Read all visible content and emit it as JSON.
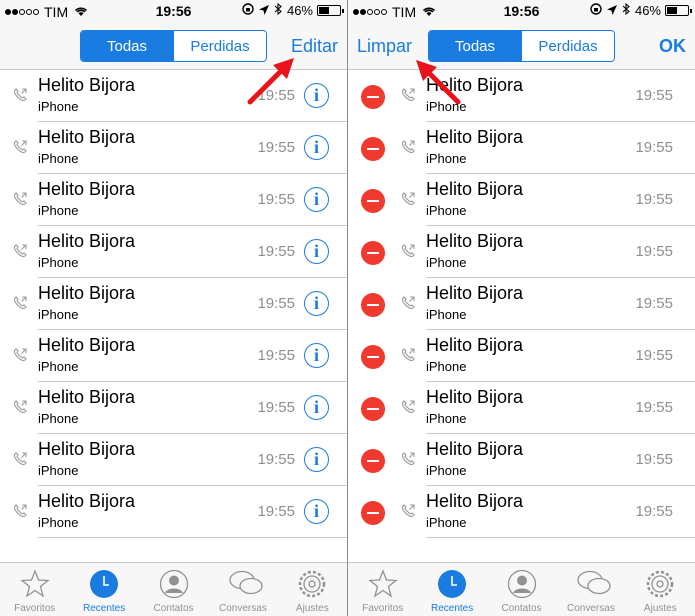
{
  "status": {
    "carrier": "TIM",
    "time": "19:56",
    "battery": "46%",
    "signal_filled": 2,
    "signal_total": 5,
    "battery_level": 0.46
  },
  "left": {
    "segments": [
      "Todas",
      "Perdidas"
    ],
    "active_segment": "Todas",
    "edit_label": "Editar"
  },
  "right": {
    "segments": [
      "Todas",
      "Perdidas"
    ],
    "active_segment": "Todas",
    "clear_label": "Limpar",
    "ok_label": "OK"
  },
  "calls": [
    {
      "name": "Helito Bijora",
      "type": "iPhone",
      "time": "19:55"
    },
    {
      "name": "Helito Bijora",
      "type": "iPhone",
      "time": "19:55"
    },
    {
      "name": "Helito Bijora",
      "type": "iPhone",
      "time": "19:55"
    },
    {
      "name": "Helito Bijora",
      "type": "iPhone",
      "time": "19:55"
    },
    {
      "name": "Helito Bijora",
      "type": "iPhone",
      "time": "19:55"
    },
    {
      "name": "Helito Bijora",
      "type": "iPhone",
      "time": "19:55"
    },
    {
      "name": "Helito Bijora",
      "type": "iPhone",
      "time": "19:55"
    },
    {
      "name": "Helito Bijora",
      "type": "iPhone",
      "time": "19:55"
    },
    {
      "name": "Helito Bijora",
      "type": "iPhone",
      "time": "19:55"
    }
  ],
  "tabs": [
    {
      "label": "Favoritos",
      "icon": "star-icon"
    },
    {
      "label": "Recentes",
      "icon": "clock-icon"
    },
    {
      "label": "Contatos",
      "icon": "contacts-icon"
    },
    {
      "label": "Conversas",
      "icon": "voicemail-icon"
    },
    {
      "label": "Ajustes",
      "icon": "settings-gear-icon"
    }
  ],
  "active_tab": "Recentes",
  "colors": {
    "accent": "#1a7ce0",
    "delete": "#f03a30",
    "arrow": "#e8131b"
  }
}
